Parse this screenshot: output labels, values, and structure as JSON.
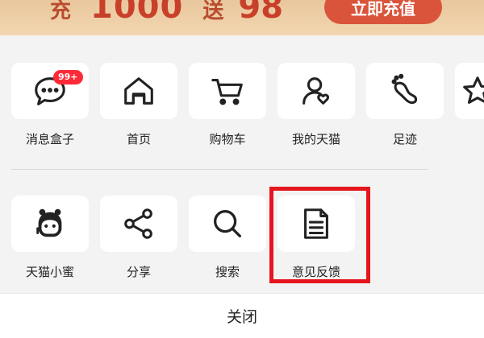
{
  "promo": {
    "prefix": "充",
    "amount": "1000",
    "middle": "送",
    "bonus": "98",
    "cta": "立即充值"
  },
  "menu": {
    "row1": [
      {
        "label": "消息盒子",
        "icon": "message-box-icon",
        "badge": "99+"
      },
      {
        "label": "首页",
        "icon": "home-icon"
      },
      {
        "label": "购物车",
        "icon": "cart-icon"
      },
      {
        "label": "我的天猫",
        "icon": "profile-icon"
      },
      {
        "label": "足迹",
        "icon": "footprint-icon"
      }
    ],
    "row2": [
      {
        "label": "天猫小蜜",
        "icon": "assistant-icon"
      },
      {
        "label": "分享",
        "icon": "share-icon"
      },
      {
        "label": "搜索",
        "icon": "search-icon"
      },
      {
        "label": "意见反馈",
        "icon": "feedback-icon"
      }
    ]
  },
  "close_label": "关闭",
  "colors": {
    "highlight": "#e5161d",
    "badge": "#ff2a37",
    "promo_text": "#c8402a",
    "promo_button": "#d9543a"
  }
}
